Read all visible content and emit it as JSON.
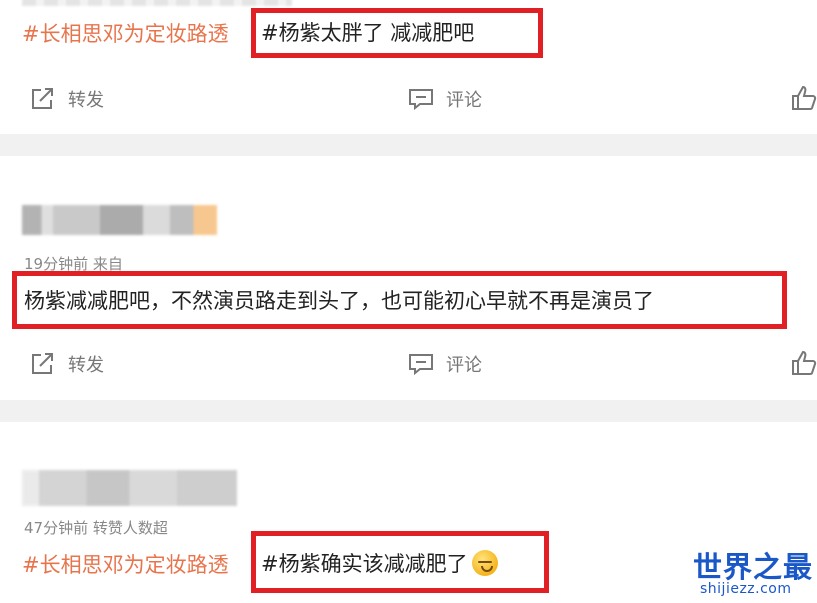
{
  "posts": [
    {
      "hashtag": "#长相思邓为定妆路透",
      "highlight": "#杨紫太胖了 减减肥吧",
      "actions": {
        "repost": "转发",
        "comment": "评论"
      }
    },
    {
      "meta": "19分钟前  来自",
      "highlight": "杨紫减减肥吧，不然演员路走到头了，也可能初心早就不再是演员了",
      "actions": {
        "repost": "转发",
        "comment": "评论"
      }
    },
    {
      "meta": "47分钟前 转赞人数超",
      "hashtag": "#长相思邓为定妆路透",
      "highlight": "#杨紫确实该减减肥了"
    }
  ],
  "watermark": {
    "cn": "世界之最",
    "en": "shijiezz.com"
  },
  "colors": {
    "hashtag": "#e8744c",
    "highlight_box": "#e12026",
    "logo": "#1a58c8"
  }
}
